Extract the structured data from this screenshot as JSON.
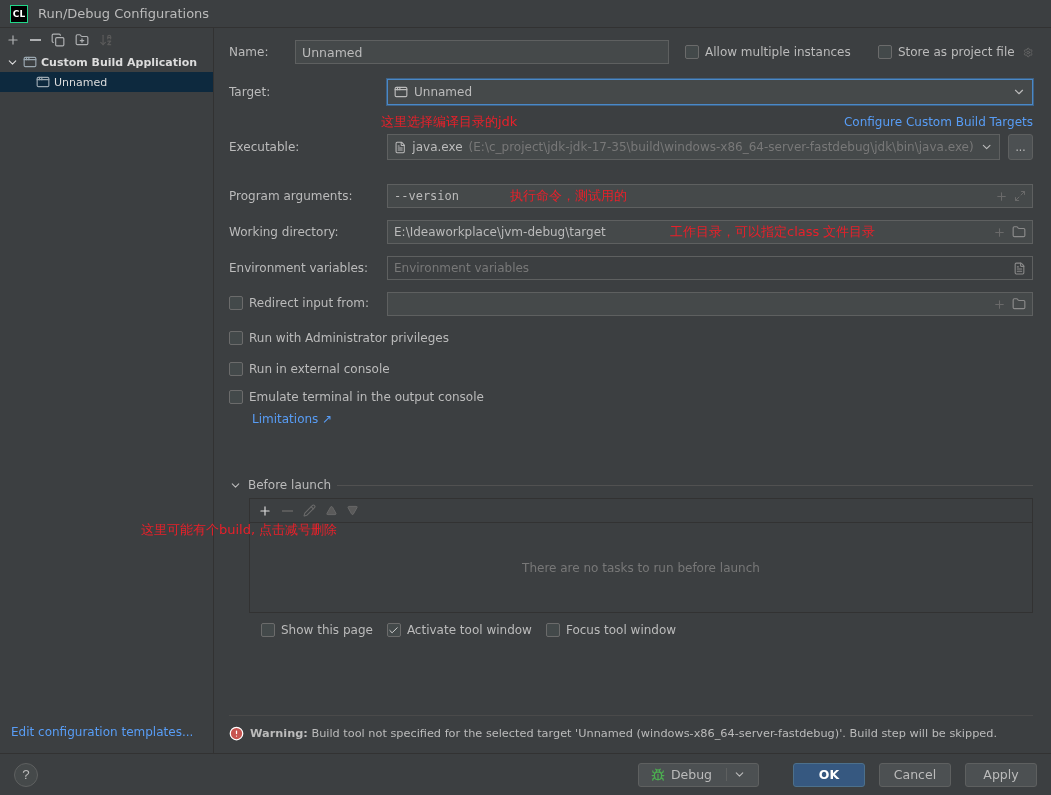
{
  "window": {
    "title": "Run/Debug Configurations",
    "logo": "CL"
  },
  "sidebar": {
    "tree": [
      {
        "label": "Custom Build Application",
        "expanded": true,
        "selected": false,
        "children": [
          {
            "label": "Unnamed",
            "selected": true
          }
        ]
      }
    ],
    "footer_link": "Edit configuration templates..."
  },
  "form": {
    "name": {
      "label": "Name:",
      "value": "Unnamed"
    },
    "options": [
      {
        "label": "Allow multiple instances",
        "checked": false
      },
      {
        "label": "Store as project file",
        "checked": false
      }
    ],
    "target": {
      "label": "Target:",
      "value": "Unnamed"
    },
    "target_note": "这里选择编译目录的jdk",
    "configure_link": "Configure Custom Build Targets",
    "executable": {
      "label": "Executable:",
      "value": "java.exe",
      "path": "(E:\\c_project\\jdk-jdk-17-35\\build\\windows-x86_64-server-fastdebug\\jdk\\bin\\java.exe)",
      "button": "..."
    },
    "program_arguments": {
      "label": "Program arguments:",
      "value": "--version",
      "note": "执行命令，测试用的"
    },
    "working_directory": {
      "label": "Working directory:",
      "value": "E:\\Ideaworkplace\\jvm-debug\\target",
      "note": "工作目录，可以指定class 文件目录"
    },
    "environment_variables": {
      "label": "Environment variables:",
      "placeholder": "Environment variables"
    },
    "redirect": {
      "label": "Redirect input from:",
      "checked": false
    },
    "checkboxes": [
      {
        "label": "Run with Administrator privileges",
        "checked": false
      },
      {
        "label": "Run in external console",
        "checked": false
      },
      {
        "label": "Emulate terminal in the output console",
        "checked": false
      }
    ],
    "limitations_link": "Limitations ↗",
    "before_launch": {
      "label": "Before launch",
      "expanded": true,
      "empty_text": "There are no tasks to run before launch",
      "note": "这里可能有个build, 点击减号删除"
    },
    "launch_options": [
      {
        "label": "Show this page",
        "checked": false
      },
      {
        "label": "Activate tool window",
        "checked": true
      },
      {
        "label": "Focus tool window",
        "checked": false
      }
    ]
  },
  "warning": "**Warning:** Build tool not specified for the selected target 'Unnamed (windows-x86_64-server-fastdebug)'. Build step will be skipped.",
  "help": "?",
  "buttons": [
    {
      "label": "Debug",
      "kind": "split"
    },
    {
      "label": "OK",
      "kind": "primary"
    },
    {
      "label": "Cancel",
      "kind": "plain"
    },
    {
      "label": "Apply",
      "kind": "plain"
    }
  ]
}
